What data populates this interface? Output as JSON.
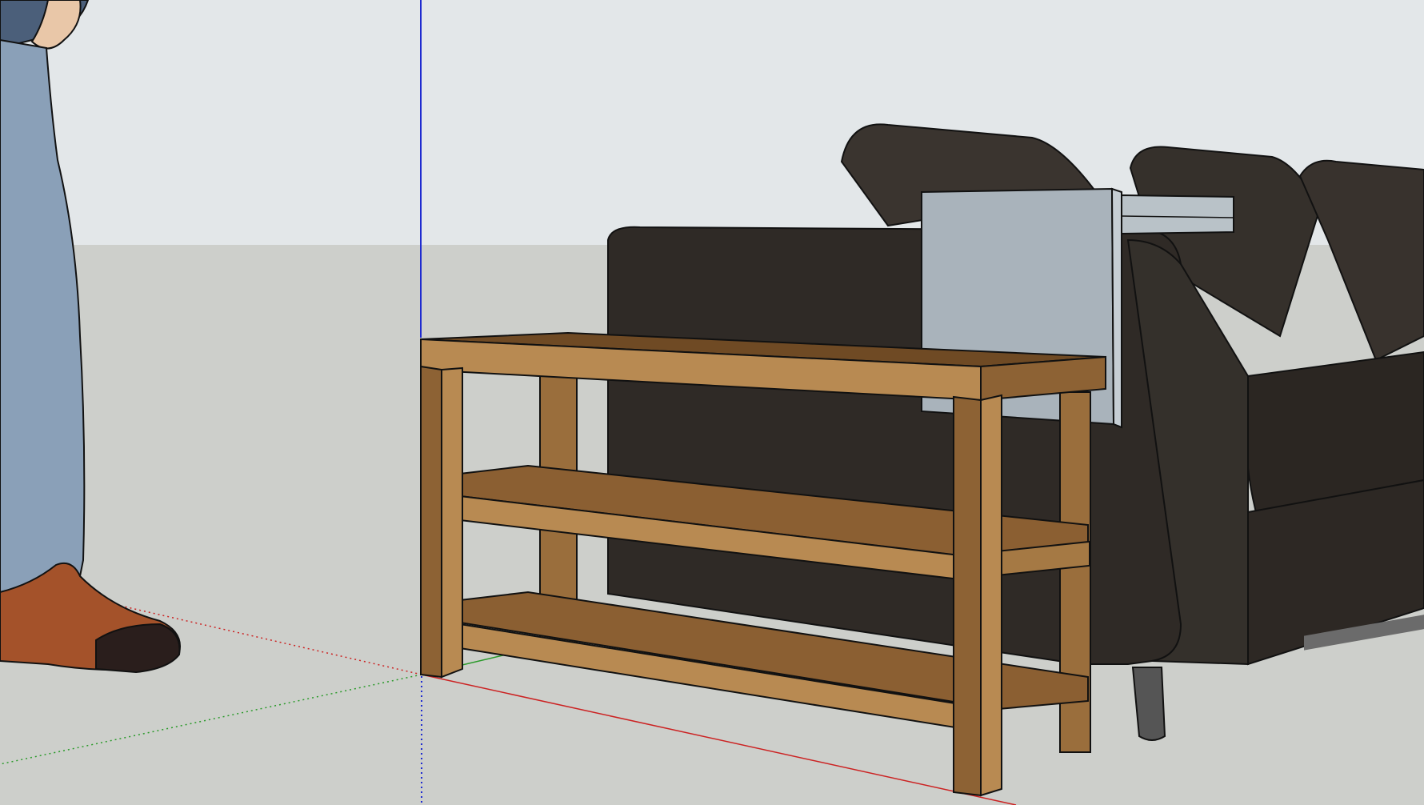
{
  "app": {
    "viewport_label": ""
  },
  "colors": {
    "sky": "#e3e7e9",
    "ground": "#cdcfcb",
    "axis_blue": "#1f2bd0",
    "axis_red": "#cc2222",
    "axis_green": "#2a9a2a",
    "wood_light": "#b88a52",
    "wood_mid": "#9a6e3c",
    "wood_dark": "#6f4a24",
    "sofa_dark": "#2f2a26",
    "sofa_mid": "#3d3731",
    "panel_gray": "#a9b3bb",
    "jeans": "#8aa0b8",
    "shoe": "#a4522a",
    "sole": "#2a1e1c"
  },
  "icons": {
    "axes": "model-axes-icon",
    "person": "scale-figure-icon"
  }
}
